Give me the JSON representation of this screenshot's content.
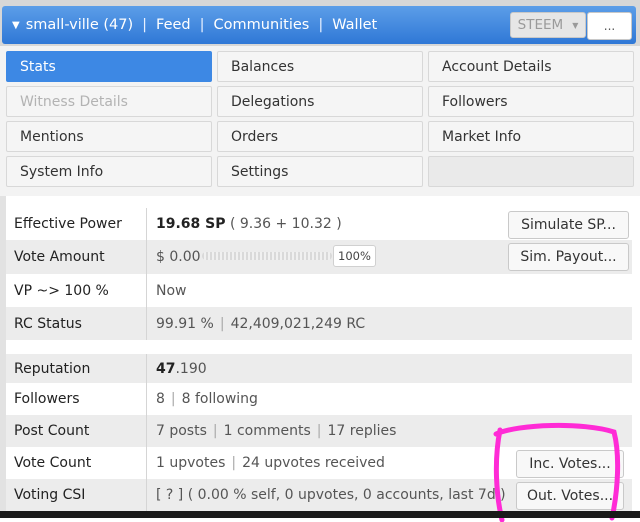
{
  "nav": {
    "account": "small-ville (47)",
    "links": [
      "Feed",
      "Communities",
      "Wallet"
    ],
    "currency": "STEEM",
    "more": "..."
  },
  "tabs": [
    [
      "Stats",
      "Balances",
      "Account Details"
    ],
    [
      "Witness Details",
      "Delegations",
      "Followers"
    ],
    [
      "Mentions",
      "Orders",
      "Market Info"
    ],
    [
      "System Info",
      "Settings",
      ""
    ]
  ],
  "rows": {
    "effective_power": {
      "label": "Effective Power",
      "value_bold": "19.68 SP",
      "value_rest": "( 9.36 + 10.32 )",
      "button": "Simulate SP..."
    },
    "vote_amount": {
      "label": "Vote Amount",
      "value": "$ 0.00",
      "percent": "100%",
      "button": "Sim. Payout..."
    },
    "vp": {
      "label": "VP ~> 100 %",
      "value": "Now"
    },
    "rc_status": {
      "label": "RC Status",
      "value_a": "99.91 %",
      "value_b": "42,409,021,249 RC"
    },
    "reputation": {
      "label": "Reputation",
      "value_bold": "47",
      "value_rest": ".190"
    },
    "followers": {
      "label": "Followers",
      "value_a": "8",
      "value_b": "8 following"
    },
    "post_count": {
      "label": "Post Count",
      "value_a": "7 posts",
      "value_b": "1 comments",
      "value_c": "17 replies"
    },
    "vote_count": {
      "label": "Vote Count",
      "value_a": "1 upvotes",
      "value_b": "24 upvotes received",
      "button": "Inc. Votes..."
    },
    "voting_csi": {
      "label": "Voting CSI",
      "value": "[ ? ] ( 0.00 % self, 0 upvotes, 0 accounts, last 7d )",
      "button": "Out. Votes..."
    }
  },
  "colors": {
    "accent": "#3d88e4",
    "highlight": "#ff2bd6"
  }
}
